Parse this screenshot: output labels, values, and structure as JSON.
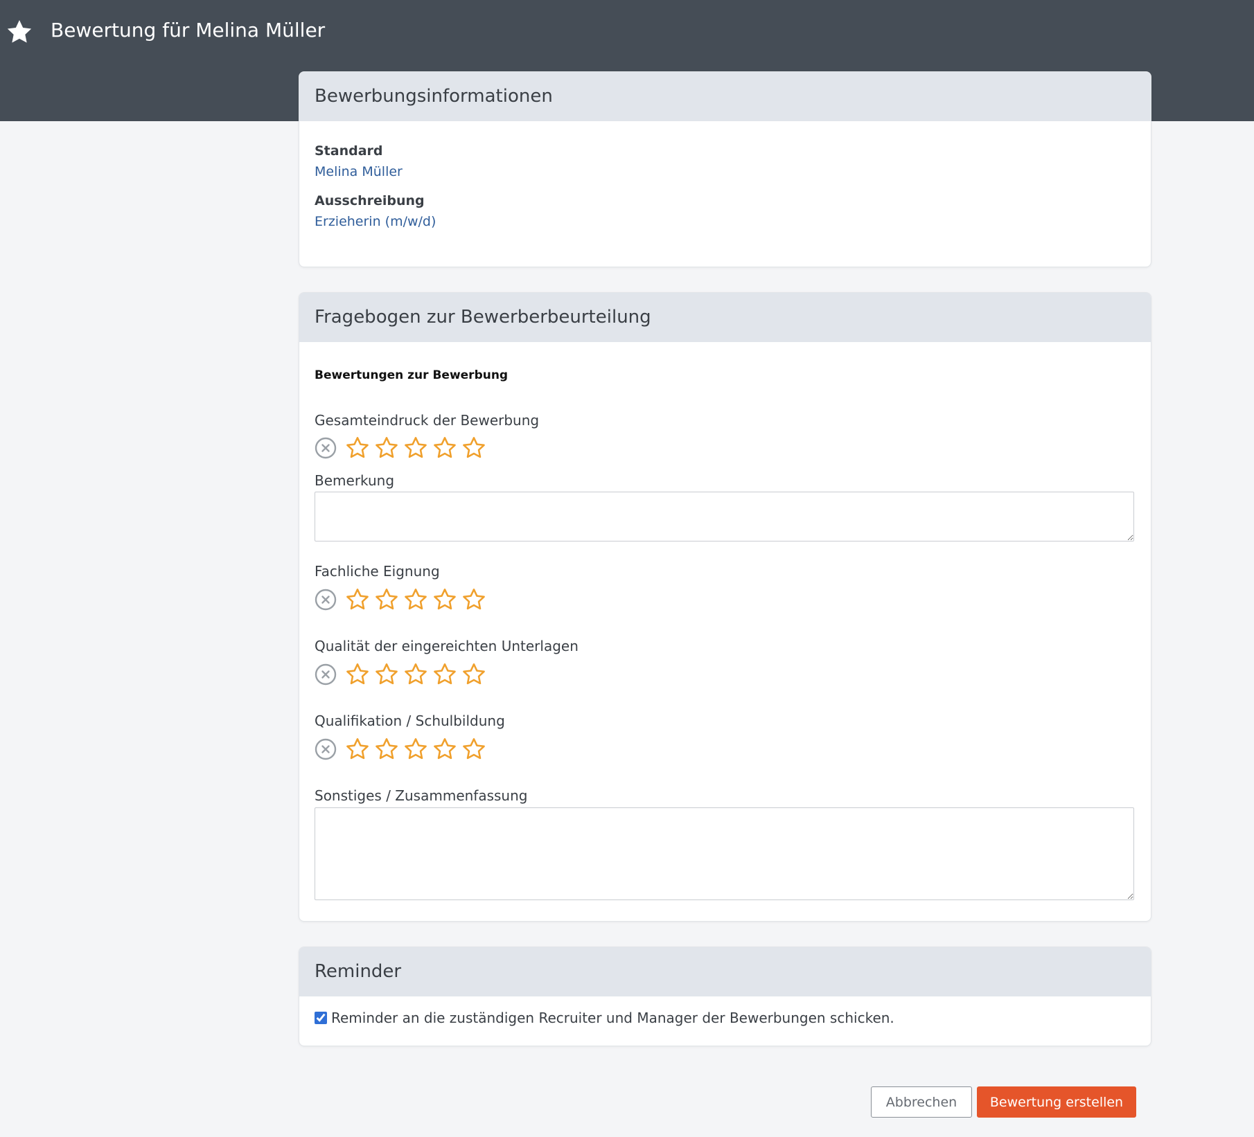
{
  "header": {
    "title": "Bewertung für Melina Müller",
    "icon": "star-icon"
  },
  "info_card": {
    "title": "Bewerbungsinformationen",
    "standard_label": "Standard",
    "standard_value": "Melina Müller",
    "posting_label": "Ausschreibung",
    "posting_value": "Erzieherin (m/w/d)"
  },
  "questionnaire": {
    "title": "Fragebogen zur Bewerberbeurteilung",
    "section_title": "Bewertungen zur Bewerbung",
    "q1_label": "Gesamteindruck der Bewerbung",
    "q1_rating": 0,
    "remark_label": "Bemerkung",
    "remark_value": "",
    "q2_label": "Fachliche Eignung",
    "q2_rating": 0,
    "q3_label": "Qualität der eingereichten Unterlagen",
    "q3_rating": 0,
    "q4_label": "Qualifikation / Schulbildung",
    "q4_rating": 0,
    "summary_label": "Sonstiges / Zusammenfassung",
    "summary_value": "",
    "max_stars": 5
  },
  "reminder": {
    "title": "Reminder",
    "checkbox_label": "Reminder an die zuständigen Recruiter und Manager der Bewerbungen schicken.",
    "checked": true
  },
  "actions": {
    "cancel_label": "Abbrechen",
    "submit_label": "Bewertung erstellen"
  },
  "colors": {
    "header_bg": "#454d56",
    "star": "#f0a02c",
    "primary": "#e5552a",
    "link": "#2f5d9a"
  }
}
